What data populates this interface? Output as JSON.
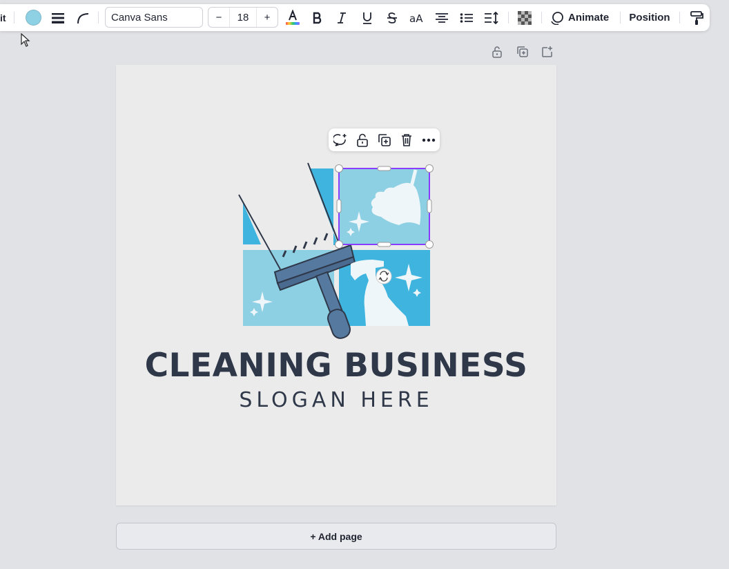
{
  "toolbar": {
    "cut_label": "it",
    "fill_color": "#8fd1e4",
    "font_family": "Canva Sans",
    "font_size": "18",
    "decrease_label": "−",
    "increase_label": "+",
    "animate_label": "Animate",
    "position_label": "Position",
    "icons": [
      "border-style-icon",
      "corner-rounding-icon",
      "text-color-icon",
      "bold-icon",
      "italic-icon",
      "underline-icon",
      "strikethrough-icon",
      "letter-case-icon",
      "align-center-icon",
      "list-icon",
      "spacing-icon",
      "transparency-icon",
      "animate-icon",
      "paint-roller-icon"
    ]
  },
  "page_actions": [
    "lock-icon",
    "duplicate-page-icon",
    "add-page-icon"
  ],
  "element_toolbar": [
    "comment-icon",
    "lock-icon",
    "duplicate-icon",
    "trash-icon",
    "more-icon"
  ],
  "design": {
    "title": "CLEANING BUSINESS",
    "slogan": "SLOGAN HERE",
    "colors": {
      "light_blue": "#8ed0e3",
      "mid_blue": "#3fb4de",
      "navy": "#56799f",
      "dark": "#2f3849"
    }
  },
  "add_page_label": "+ Add page"
}
